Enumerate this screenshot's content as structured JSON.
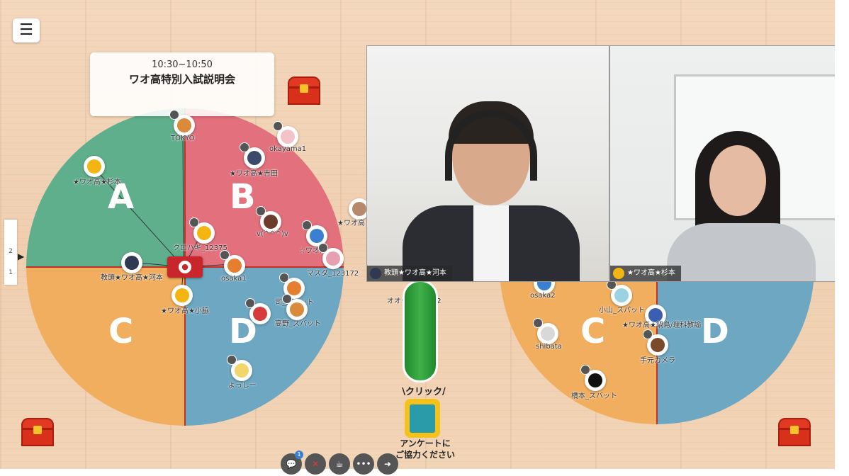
{
  "menu_icon": "hamburger-icon",
  "side_tabs": [
    "",
    "2",
    "1"
  ],
  "event": {
    "time": "10:30~10:50",
    "title": "ワオ高特別入試説明会"
  },
  "left_board": {
    "zones": [
      "A",
      "B",
      "C",
      "D"
    ]
  },
  "right_board": {
    "zones": [
      "C",
      "D"
    ]
  },
  "colors": {
    "A": "#5fae8c",
    "B": "#e2707d",
    "C": "#f1ae5f",
    "D": "#6ea7c2"
  },
  "participants_left": [
    {
      "name": "TOKYO"
    },
    {
      "name": "okayama1"
    },
    {
      "name": "★ワオ高★吉田"
    },
    {
      "name": "★ワオ高★杉本"
    },
    {
      "name": "クロハギ_12375"
    },
    {
      "name": "v(^^^)v"
    },
    {
      "name": "☆ワオ高☆"
    },
    {
      "name": "マスダ_123172"
    },
    {
      "name": "教頭★ワオ高★河本"
    },
    {
      "name": "osaka1"
    },
    {
      "name": "★ワオ高★小脇"
    },
    {
      "name": "司_スバット"
    },
    {
      "name": "高野_スバット"
    },
    {
      "name": "よっしー"
    },
    {
      "name": "★ワオ高"
    },
    {
      "name": "オオクボ_12352"
    }
  ],
  "participants_right": [
    {
      "name": "osaka2"
    },
    {
      "name": "小山_スパット"
    },
    {
      "name": "★ワオ高★鍋島/理科教諭"
    },
    {
      "name": "shibata"
    },
    {
      "name": "手元カメラ"
    },
    {
      "name": "橋本_スバット"
    }
  ],
  "videos": [
    {
      "label": "教頭★ワオ高★河本"
    },
    {
      "label": "★ワオ高★杉本"
    }
  ],
  "click_label": "\\クリック/",
  "survey": {
    "line1": "アンケートに",
    "line2": "ご協力ください"
  },
  "toolbar": {
    "chat_badge": "1",
    "buttons": [
      "chat-icon",
      "mic-muted-icon",
      "coffee-icon",
      "more-icon",
      "exit-icon"
    ]
  }
}
